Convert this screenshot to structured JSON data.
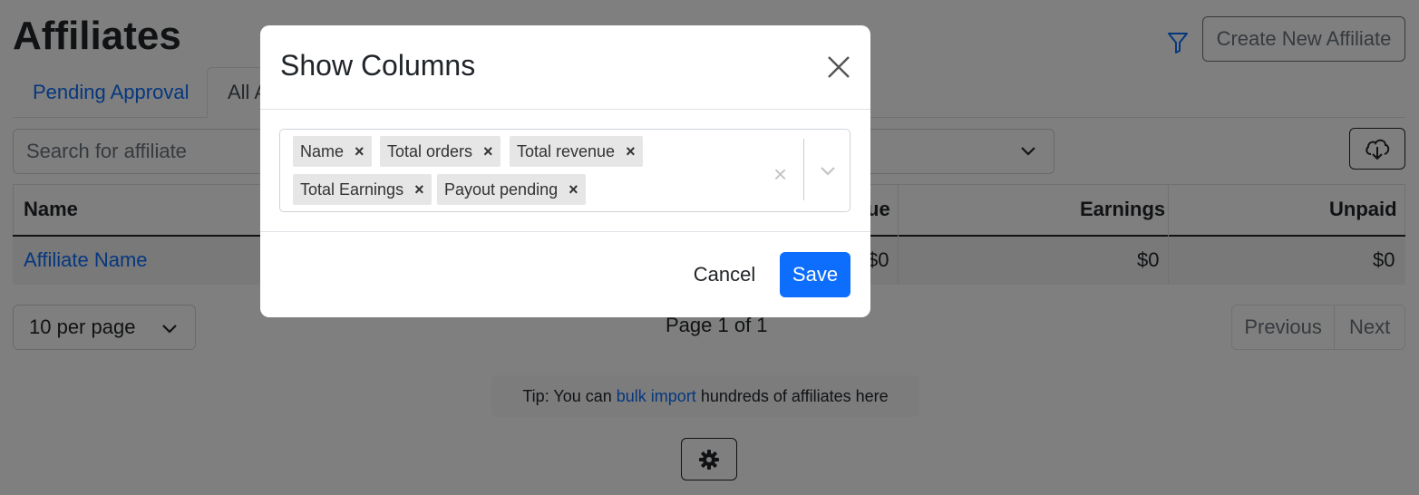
{
  "page": {
    "title": "Affiliates",
    "create_button": "Create New Affiliate",
    "tabs": [
      {
        "label": "Pending Approval"
      },
      {
        "label": "All A"
      }
    ],
    "search_placeholder": "Search for affiliate",
    "table": {
      "headers": [
        "Name",
        "ue",
        "Earnings",
        "Unpaid"
      ],
      "row": {
        "name": "Affiliate Name",
        "revenue": "$0",
        "earnings": "$0",
        "unpaid": "$0"
      }
    },
    "per_page": "10 per page",
    "page_info": "Page 1 of 1",
    "pager": {
      "previous": "Previous",
      "next": "Next"
    },
    "tip": {
      "prefix": "Tip: You can",
      "link": "bulk import",
      "suffix": "hundreds of affiliates here"
    }
  },
  "modal": {
    "title": "Show Columns",
    "chips": [
      {
        "label": "Name"
      },
      {
        "label": "Total orders"
      },
      {
        "label": "Total revenue"
      },
      {
        "label": "Total Earnings"
      },
      {
        "label": "Payout pending"
      }
    ],
    "chip_remove_glyph": "×",
    "clear_glyph": "×",
    "cancel": "Cancel",
    "save": "Save"
  },
  "colors": {
    "primary": "#0d6efd",
    "backdrop": "rgba(0,0,0,0.5)",
    "chip_bg": "#e6e6e6"
  },
  "icons": [
    "filter-icon",
    "download-cloud-icon",
    "gear-icon",
    "close-icon",
    "chevron-down-icon"
  ]
}
